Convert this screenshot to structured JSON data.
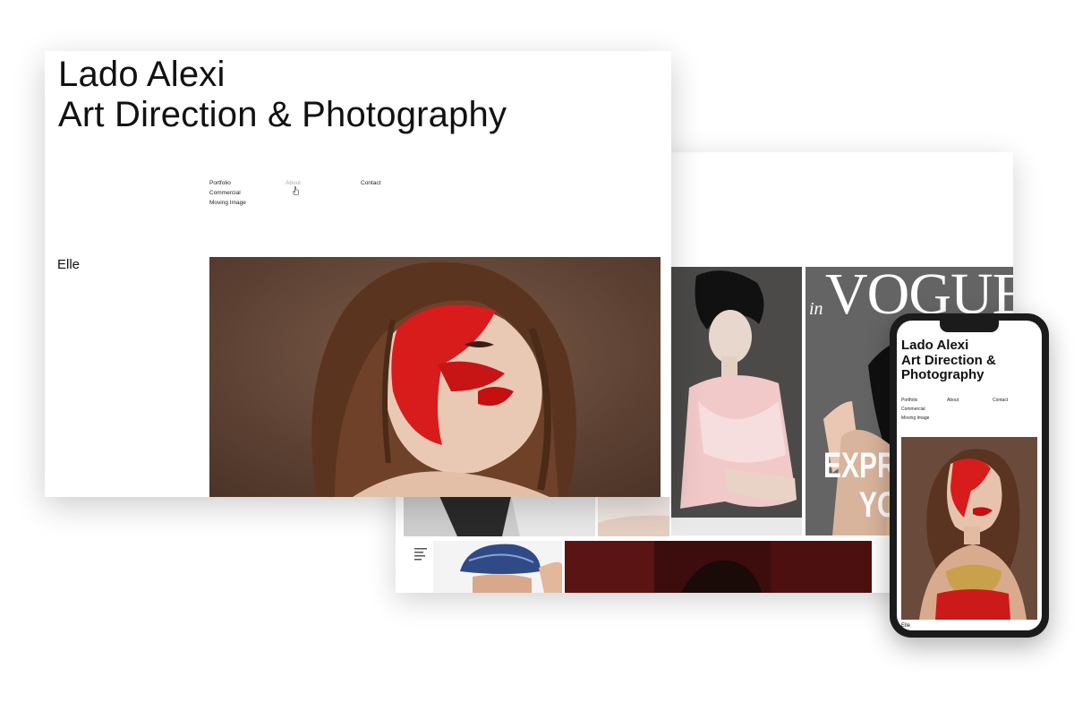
{
  "site": {
    "title_line1": "Lado Alexi",
    "title_line2": "Art Direction & Photography",
    "nav": {
      "portfolio": "Portfolio",
      "commercial": "Commercial",
      "moving_image": "Moving Image",
      "about": "About",
      "contact": "Contact"
    },
    "section_label": "Elle"
  },
  "gallery": {
    "magazine_masthead": "VOGUE",
    "magazine_prefix": "in",
    "magazine_coverline": "EXPR",
    "magazine_coverline2": "YO"
  },
  "mobile": {
    "title_line1": "Lado Alexi",
    "title_line2": "Art Direction &",
    "title_line3": "Photography",
    "nav": {
      "portfolio": "Portfolio",
      "commercial": "Commercial",
      "moving_image": "Moving Image",
      "about": "About",
      "contact": "Contact"
    },
    "caption": "Elle"
  },
  "icons": [
    "hand-pointer-cursor-icon"
  ],
  "colors": {
    "background": "#ffffff",
    "text": "#111111",
    "nav_hover": "#aaaaaa",
    "phone_frame": "#1b1b1b",
    "accent_red": "#d81c1c"
  }
}
